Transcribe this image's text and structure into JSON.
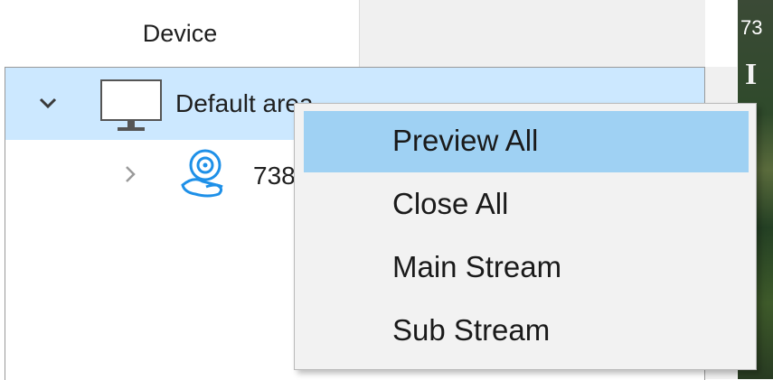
{
  "panel": {
    "header": "Device"
  },
  "tree": {
    "group_label": "Default area",
    "camera_label": "738"
  },
  "video": {
    "title": "73",
    "overlay": "I"
  },
  "context_menu": {
    "items": [
      {
        "label": "Preview All",
        "highlighted": true
      },
      {
        "label": "Close All",
        "highlighted": false
      },
      {
        "label": "Main Stream",
        "highlighted": false
      },
      {
        "label": "Sub Stream",
        "highlighted": false
      }
    ]
  },
  "colors": {
    "selection": "#cce8ff",
    "menu_hover": "#9fd1f3",
    "menu_bg": "#f2f2f2",
    "camera_icon": "#1e90e8"
  },
  "icons": {
    "expand": "chevron-down-icon",
    "collapse": "chevron-right-icon",
    "group": "monitor-icon",
    "camera": "webcam-icon"
  }
}
